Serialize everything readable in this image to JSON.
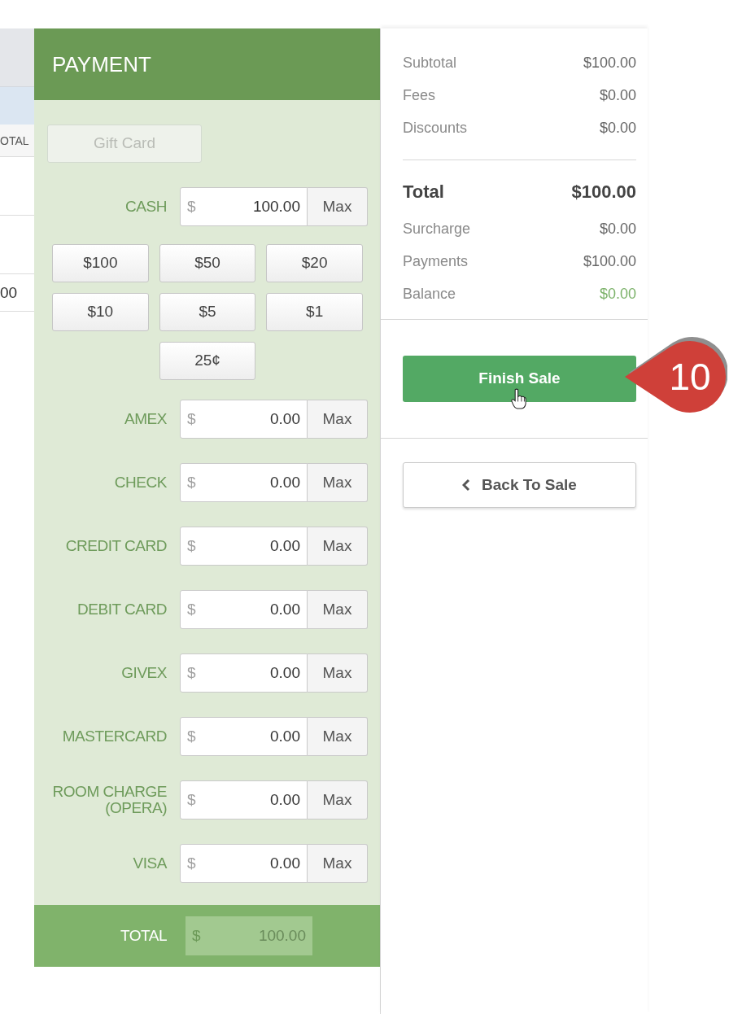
{
  "order_table": {
    "column_header": "OTAL",
    "cell": "00"
  },
  "payment": {
    "title": "PAYMENT",
    "gift_card": {
      "label": "Gift Card",
      "disabled": true
    },
    "methods": [
      {
        "label": "CASH",
        "currency": "$",
        "value": "100.00",
        "button": "Max",
        "quick_amounts": [
          "$100",
          "$50",
          "$20",
          "$10",
          "$5",
          "$1",
          "25¢"
        ]
      },
      {
        "label": "AMEX",
        "currency": "$",
        "value": "0.00",
        "button": "Max"
      },
      {
        "label": "CHECK",
        "currency": "$",
        "value": "0.00",
        "button": "Max"
      },
      {
        "label": "CREDIT CARD",
        "currency": "$",
        "value": "0.00",
        "button": "Max"
      },
      {
        "label": "DEBIT CARD",
        "currency": "$",
        "value": "0.00",
        "button": "Max"
      },
      {
        "label": "GIVEX",
        "currency": "$",
        "value": "0.00",
        "button": "Max"
      },
      {
        "label": "MASTERCARD",
        "currency": "$",
        "value": "0.00",
        "button": "Max"
      },
      {
        "label": "ROOM CHARGE (OPERA)",
        "currency": "$",
        "value": "0.00",
        "button": "Max"
      },
      {
        "label": "VISA",
        "currency": "$",
        "value": "0.00",
        "button": "Max"
      }
    ],
    "total": {
      "label": "TOTAL",
      "currency": "$",
      "value": "100.00"
    }
  },
  "summary": {
    "lines": [
      {
        "label": "Subtotal",
        "value": "$100.00"
      },
      {
        "label": "Fees",
        "value": "$0.00"
      },
      {
        "label": "Discounts",
        "value": "$0.00"
      }
    ],
    "total": {
      "label": "Total",
      "value": "$100.00"
    },
    "payment_lines": [
      {
        "label": "Surcharge",
        "value": "$0.00",
        "kind": "plain"
      },
      {
        "label": "Payments",
        "value": "$100.00",
        "kind": "plain"
      },
      {
        "label": "Balance",
        "value": "$0.00",
        "kind": "balance"
      }
    ]
  },
  "actions": [
    {
      "label": "Finish Sale",
      "kind": "primary"
    },
    {
      "label": "Back To Sale",
      "kind": "back"
    }
  ],
  "callout": {
    "label": "10"
  }
}
